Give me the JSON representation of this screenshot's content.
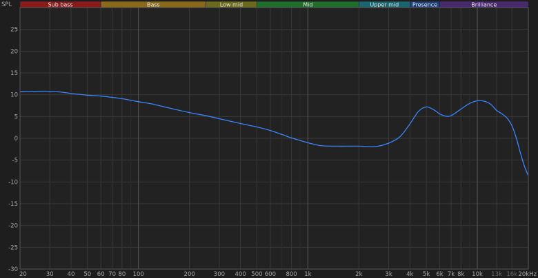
{
  "chart_data": {
    "type": "line",
    "ylabel": "SPL",
    "xlabel": "",
    "x_scale": "log",
    "xlim": [
      20,
      20000
    ],
    "ylim": [
      -30,
      30
    ],
    "y_ticks": [
      -30,
      -25,
      -20,
      -15,
      -10,
      -5,
      0,
      5,
      10,
      15,
      20,
      25
    ],
    "y_tick_labels": [
      "-30",
      "-25",
      "-20",
      "-15",
      "-10",
      "-5",
      "0",
      "5",
      "10",
      "15",
      "20",
      "25"
    ],
    "x_ticks": [
      {
        "value": 20,
        "label": "20",
        "emphasis": false
      },
      {
        "value": 30,
        "label": "30",
        "emphasis": false
      },
      {
        "value": 40,
        "label": "40",
        "emphasis": false
      },
      {
        "value": 50,
        "label": "50",
        "emphasis": false
      },
      {
        "value": 60,
        "label": "60",
        "emphasis": false
      },
      {
        "value": 70,
        "label": "70",
        "emphasis": false
      },
      {
        "value": 80,
        "label": "80",
        "emphasis": false
      },
      {
        "value": 100,
        "label": "100",
        "emphasis": true
      },
      {
        "value": 200,
        "label": "200",
        "emphasis": false
      },
      {
        "value": 300,
        "label": "300",
        "emphasis": false
      },
      {
        "value": 400,
        "label": "400",
        "emphasis": false
      },
      {
        "value": 500,
        "label": "500",
        "emphasis": false
      },
      {
        "value": 600,
        "label": "600",
        "emphasis": false
      },
      {
        "value": 800,
        "label": "800",
        "emphasis": false
      },
      {
        "value": 1000,
        "label": "1k",
        "emphasis": true
      },
      {
        "value": 2000,
        "label": "2k",
        "emphasis": false
      },
      {
        "value": 3000,
        "label": "3k",
        "emphasis": false
      },
      {
        "value": 4000,
        "label": "4k",
        "emphasis": false
      },
      {
        "value": 5000,
        "label": "5k",
        "emphasis": false
      },
      {
        "value": 6000,
        "label": "6k",
        "emphasis": false
      },
      {
        "value": 7000,
        "label": "7k",
        "emphasis": false
      },
      {
        "value": 8000,
        "label": "8k",
        "emphasis": false
      },
      {
        "value": 10000,
        "label": "10k",
        "emphasis": true
      },
      {
        "value": 13000,
        "label": "13k",
        "emphasis": false,
        "dim": true
      },
      {
        "value": 16000,
        "label": "16k",
        "emphasis": false,
        "dim": true
      },
      {
        "value": 20000,
        "label": "20kHz",
        "emphasis": false
      }
    ],
    "bands": [
      {
        "label": "Sub bass",
        "from": 20,
        "to": 60,
        "color": "#8b1a1a"
      },
      {
        "label": "Bass",
        "from": 60,
        "to": 250,
        "color": "#8a6a1a"
      },
      {
        "label": "Low mid",
        "from": 250,
        "to": 500,
        "color": "#6b6a1a"
      },
      {
        "label": "Mid",
        "from": 500,
        "to": 2000,
        "color": "#1f6e2a"
      },
      {
        "label": "Upper mid",
        "from": 2000,
        "to": 4000,
        "color": "#1a6670"
      },
      {
        "label": "Presence",
        "from": 4000,
        "to": 6000,
        "color": "#1e3f7a"
      },
      {
        "label": "Brilliance",
        "from": 6000,
        "to": 20000,
        "color": "#4a2a6e"
      }
    ],
    "grid": true,
    "series": [
      {
        "color": "#3a86ff",
        "points": [
          [
            20,
            10.7
          ],
          [
            25,
            10.8
          ],
          [
            30,
            10.8
          ],
          [
            35,
            10.6
          ],
          [
            40,
            10.3
          ],
          [
            50,
            9.9
          ],
          [
            60,
            9.7
          ],
          [
            70,
            9.4
          ],
          [
            80,
            9.1
          ],
          [
            100,
            8.4
          ],
          [
            120,
            7.9
          ],
          [
            150,
            7.0
          ],
          [
            200,
            5.9
          ],
          [
            250,
            5.2
          ],
          [
            300,
            4.5
          ],
          [
            400,
            3.4
          ],
          [
            500,
            2.6
          ],
          [
            600,
            1.8
          ],
          [
            700,
            0.9
          ],
          [
            800,
            0.1
          ],
          [
            900,
            -0.5
          ],
          [
            1000,
            -1.0
          ],
          [
            1200,
            -1.7
          ],
          [
            1500,
            -1.8
          ],
          [
            2000,
            -1.8
          ],
          [
            2500,
            -1.9
          ],
          [
            3000,
            -1.1
          ],
          [
            3500,
            0.4
          ],
          [
            4000,
            3.3
          ],
          [
            4500,
            6.2
          ],
          [
            5000,
            7.2
          ],
          [
            5500,
            6.6
          ],
          [
            6000,
            5.6
          ],
          [
            6500,
            5.1
          ],
          [
            7000,
            5.2
          ],
          [
            8000,
            6.7
          ],
          [
            9000,
            8.0
          ],
          [
            10000,
            8.6
          ],
          [
            11000,
            8.5
          ],
          [
            12000,
            7.8
          ],
          [
            13000,
            6.4
          ],
          [
            14000,
            5.6
          ],
          [
            15000,
            4.6
          ],
          [
            16000,
            2.9
          ],
          [
            17000,
            0.0
          ],
          [
            18000,
            -3.5
          ],
          [
            19000,
            -6.5
          ],
          [
            20000,
            -8.6
          ]
        ]
      }
    ]
  }
}
